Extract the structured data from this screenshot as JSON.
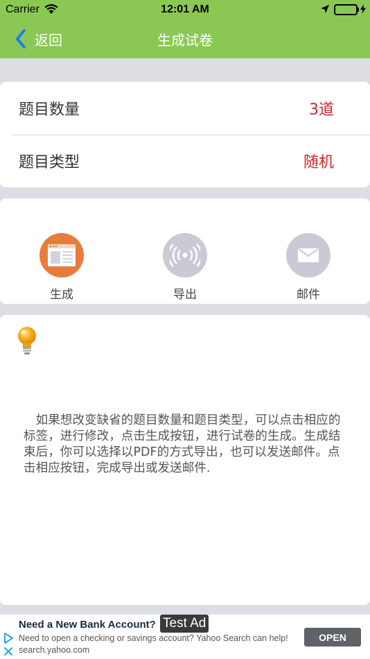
{
  "status_bar": {
    "carrier": "Carrier",
    "time": "12:01 AM"
  },
  "nav": {
    "back_label": "返回",
    "title": "生成试卷"
  },
  "settings": {
    "rows": [
      {
        "label": "题目数量",
        "value": "3道"
      },
      {
        "label": "题目类型",
        "value": "随机"
      }
    ]
  },
  "actions": [
    {
      "label": "生成",
      "icon": "document-window-icon",
      "color": "#e77c3d"
    },
    {
      "label": "导出",
      "icon": "broadcast-icon",
      "color": "#c9cad6"
    },
    {
      "label": "邮件",
      "icon": "envelope-icon",
      "color": "#c9cad6"
    }
  ],
  "tip": {
    "icon": "lightbulb-icon",
    "text": "　如果想改变缺省的题目数量和题目类型，可以点击相应的标签，进行修改，点击生成按钮，进行试卷的生成。生成结束后，你可以选择以PDF的方式导出，也可以发送邮件。点击相应按钮，完成导出或发送邮件."
  },
  "ad": {
    "headline": "Need a New Bank Account?",
    "badge": "Test Ad",
    "body": "Need to open a checking or savings account? Yahoo Search can help!",
    "url": "search.yahoo.com",
    "cta": "OPEN"
  },
  "colors": {
    "nav_green": "#8bc853",
    "value_red": "#c9262b",
    "background": "#dcdee4"
  }
}
